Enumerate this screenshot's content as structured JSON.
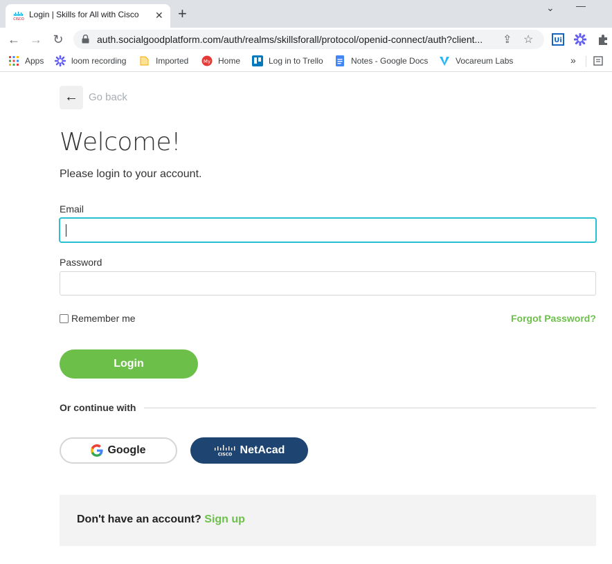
{
  "browser": {
    "tab_title": "Login | Skills for All with Cisco",
    "url": "auth.socialgoodplatform.com/auth/realms/skillsforall/protocol/openid-connect/auth?client...",
    "bookmarks": [
      {
        "label": "Apps",
        "icon": "apps-grid-icon"
      },
      {
        "label": "loom recording",
        "icon": "loom-icon"
      },
      {
        "label": "Imported",
        "icon": "folder-icon"
      },
      {
        "label": "Home",
        "icon": "home-icon"
      },
      {
        "label": "Log in to Trello",
        "icon": "trello-icon"
      },
      {
        "label": "Notes - Google Docs",
        "icon": "google-docs-icon"
      },
      {
        "label": "Vocareum Labs",
        "icon": "vocareum-icon"
      }
    ]
  },
  "page": {
    "back_label": "Go back",
    "title": "Welcome!",
    "subtitle": "Please login to your account.",
    "email_label": "Email",
    "email_value": "",
    "password_label": "Password",
    "password_value": "",
    "remember_label": "Remember me",
    "remember_checked": false,
    "forgot_label": "Forgot Password?",
    "login_label": "Login",
    "continue_label": "Or continue with",
    "google_label": "Google",
    "netacad_label": "NetAcad",
    "no_account_label": "Don't have an account?",
    "signup_label": "Sign up"
  },
  "colors": {
    "accent_green": "#6cc04a",
    "netacad_blue": "#1e4471",
    "focus_teal": "#27c0d0"
  }
}
